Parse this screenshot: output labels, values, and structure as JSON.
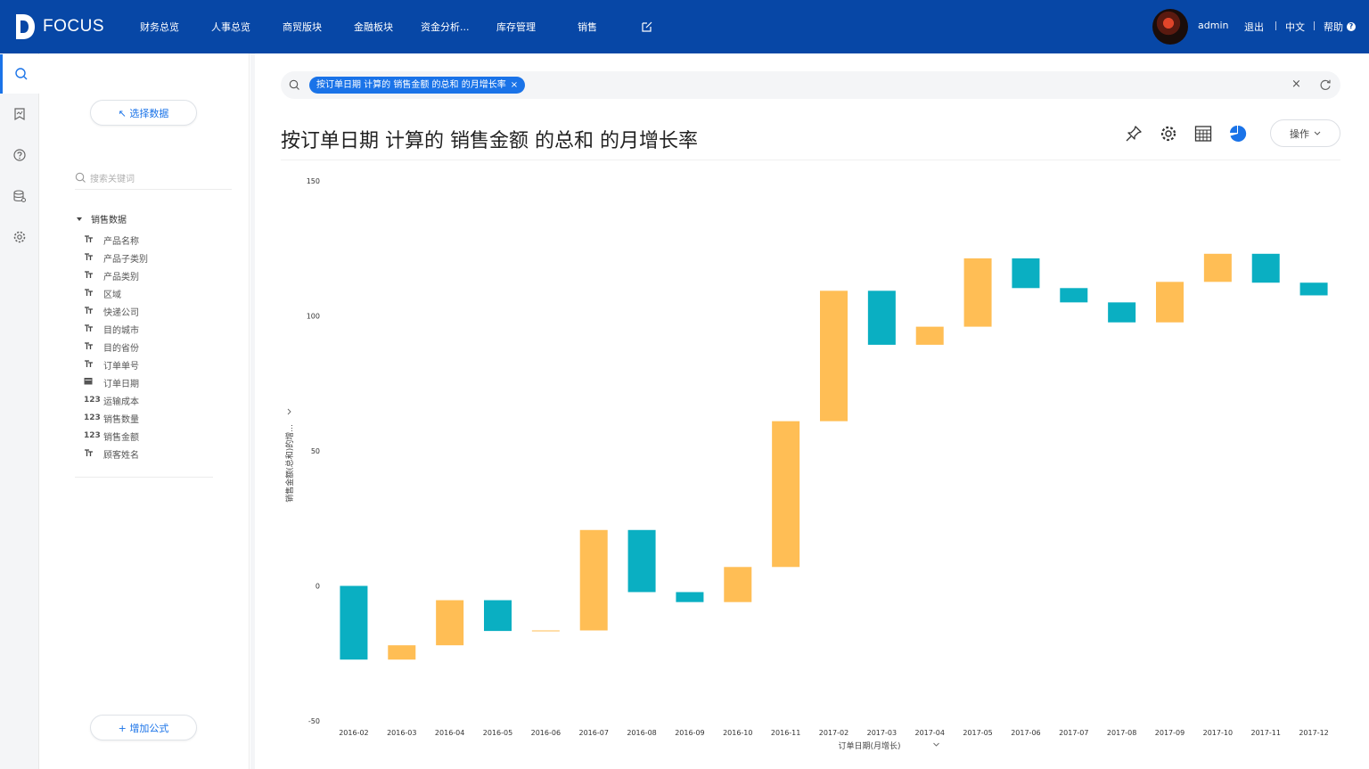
{
  "app": {
    "brand": "FOCUS"
  },
  "nav": {
    "items": [
      "财务总览",
      "人事总览",
      "商贸版块",
      "金融板块",
      "资金分析...",
      "库存管理",
      "销售"
    ],
    "edit_icon": "edit-icon"
  },
  "user": {
    "name": "admin",
    "logout": "退出",
    "lang": "中文",
    "help": "帮助"
  },
  "rail": {
    "icons": [
      "search-icon",
      "bookmark-icon",
      "help-icon",
      "database-icon",
      "settings-icon"
    ]
  },
  "panel": {
    "select_data": "↖ 选择数据",
    "search_placeholder": "搜索关键词",
    "table_name": "销售数据",
    "fields": [
      {
        "type": "T",
        "name": "产品名称"
      },
      {
        "type": "T",
        "name": "产品子类别"
      },
      {
        "type": "T",
        "name": "产品类别"
      },
      {
        "type": "T",
        "name": "区域"
      },
      {
        "type": "T",
        "name": "快递公司"
      },
      {
        "type": "T",
        "name": "目的城市"
      },
      {
        "type": "T",
        "name": "目的省份"
      },
      {
        "type": "T",
        "name": "订单单号"
      },
      {
        "type": "date",
        "name": "订单日期"
      },
      {
        "type": "123",
        "name": "运输成本"
      },
      {
        "type": "123",
        "name": "销售数量"
      },
      {
        "type": "123",
        "name": "销售金额"
      },
      {
        "type": "T",
        "name": "顾客姓名"
      }
    ],
    "add_formula": "+ 增加公式"
  },
  "search": {
    "chip": "按订单日期 计算的 销售金额 的总和 的月增长率",
    "chip_close": "×",
    "clear": "×"
  },
  "main": {
    "title": "按订单日期 计算的 销售金额 的总和 的月增长率",
    "operate": "操作",
    "tools": [
      "pin-icon",
      "settings-icon",
      "table-icon",
      "pie-chart-icon"
    ]
  },
  "colors": {
    "topbar": "#0747a6",
    "accent": "#1a73e8",
    "increase": "#ffbe55",
    "decrease": "#0aafc2"
  },
  "chart_data": {
    "type": "waterfall",
    "xlabel": "订单日期(月增长)",
    "ylabel": "销售金额(总和)的增...",
    "ylim": [
      -50,
      150
    ],
    "yticks": [
      -50,
      0,
      50,
      100,
      150
    ],
    "categories": [
      "2016-02",
      "2016-03",
      "2016-04",
      "2016-05",
      "2016-06",
      "2016-07",
      "2016-08",
      "2016-09",
      "2016-10",
      "2016-11",
      "2017-02",
      "2017-03",
      "2017-04",
      "2017-05",
      "2017-06",
      "2017-07",
      "2017-08",
      "2017-09",
      "2017-10",
      "2017-11",
      "2017-12"
    ],
    "bars": [
      {
        "start": 0,
        "end": -27.3
      },
      {
        "start": -27.3,
        "end": -22
      },
      {
        "start": -22,
        "end": -5.3
      },
      {
        "start": -5.3,
        "end": -16.7
      },
      {
        "start": -16.7,
        "end": -16.5
      },
      {
        "start": -16.5,
        "end": 20.7
      },
      {
        "start": 20.7,
        "end": -2.3
      },
      {
        "start": -2.3,
        "end": -6
      },
      {
        "start": -6,
        "end": 7
      },
      {
        "start": 7,
        "end": 61
      },
      {
        "start": 61,
        "end": 109.3
      },
      {
        "start": 109.3,
        "end": 89.3
      },
      {
        "start": 89.3,
        "end": 96
      },
      {
        "start": 96,
        "end": 121.3
      },
      {
        "start": 121.3,
        "end": 110.3
      },
      {
        "start": 110.3,
        "end": 105
      },
      {
        "start": 105,
        "end": 97.6
      },
      {
        "start": 97.6,
        "end": 112.6
      },
      {
        "start": 112.6,
        "end": 123
      },
      {
        "start": 123,
        "end": 112.3
      },
      {
        "start": 112.3,
        "end": 107.6
      }
    ]
  }
}
